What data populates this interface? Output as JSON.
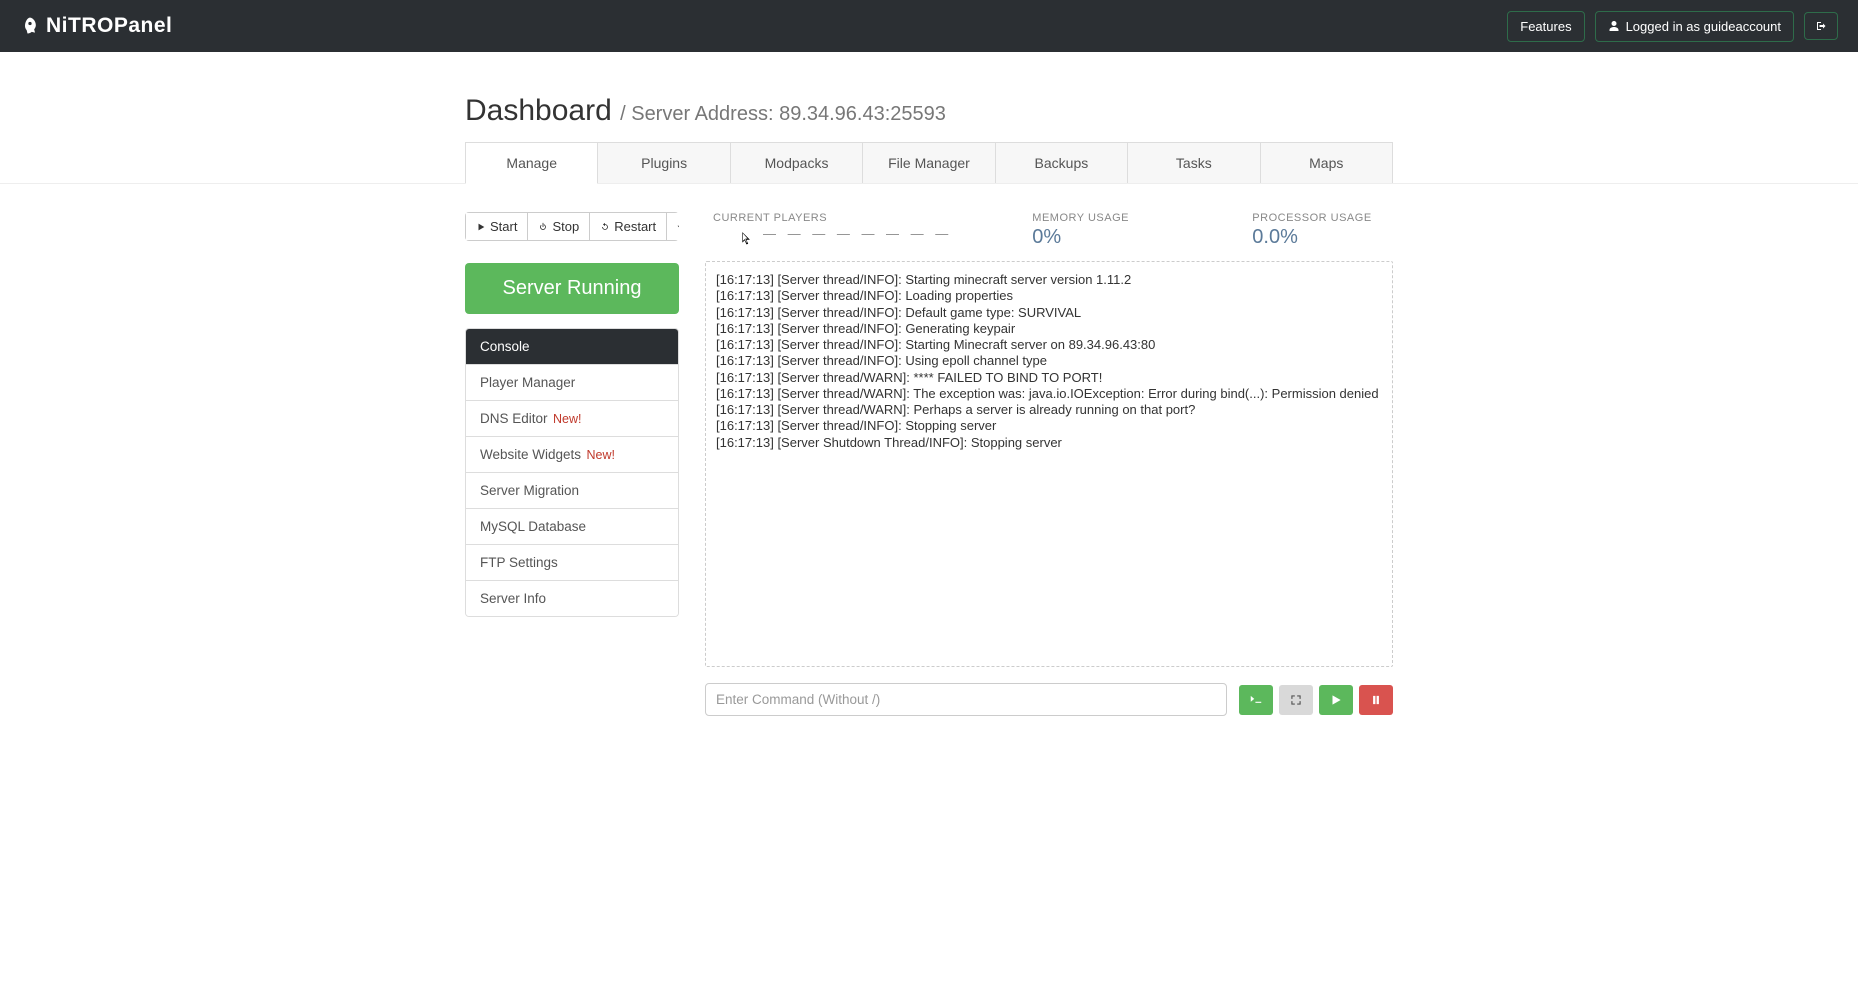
{
  "brand": "NiTROPanel",
  "header": {
    "features_label": "Features",
    "logged_in_prefix": "Logged in as ",
    "username": "guideaccount"
  },
  "page": {
    "title": "Dashboard",
    "subtitle_prefix": " / Server Address: ",
    "server_address": "89.34.96.43:25593"
  },
  "tabs": [
    "Manage",
    "Plugins",
    "Modpacks",
    "File Manager",
    "Backups",
    "Tasks",
    "Maps"
  ],
  "active_tab": 0,
  "controls": {
    "start": "Start",
    "stop": "Stop",
    "restart": "Restart"
  },
  "status_banner": "Server Running",
  "side_menu": [
    {
      "label": "Console",
      "new": false,
      "active": true
    },
    {
      "label": "Player Manager",
      "new": false,
      "active": false
    },
    {
      "label": "DNS Editor",
      "new": true,
      "active": false
    },
    {
      "label": "Website Widgets",
      "new": true,
      "active": false
    },
    {
      "label": "Server Migration",
      "new": false,
      "active": false
    },
    {
      "label": "MySQL Database",
      "new": false,
      "active": false
    },
    {
      "label": "FTP Settings",
      "new": false,
      "active": false
    },
    {
      "label": "Server Info",
      "new": false,
      "active": false
    }
  ],
  "new_badge_text": "New!",
  "stats": {
    "players_label": "CURRENT PLAYERS",
    "players_value": "— — — — — — — —",
    "memory_label": "MEMORY USAGE",
    "memory_value": "0%",
    "cpu_label": "PROCESSOR USAGE",
    "cpu_value": "0.0%"
  },
  "console_lines": [
    "[16:17:13] [Server thread/INFO]: Starting minecraft server version 1.11.2",
    "[16:17:13] [Server thread/INFO]: Loading properties",
    "[16:17:13] [Server thread/INFO]: Default game type: SURVIVAL",
    "[16:17:13] [Server thread/INFO]: Generating keypair",
    "[16:17:13] [Server thread/INFO]: Starting Minecraft server on 89.34.96.43:80",
    "[16:17:13] [Server thread/INFO]: Using epoll channel type",
    "[16:17:13] [Server thread/WARN]: **** FAILED TO BIND TO PORT!",
    "[16:17:13] [Server thread/WARN]: The exception was: java.io.IOException: Error during bind(...): Permission denied",
    "[16:17:13] [Server thread/WARN]: Perhaps a server is already running on that port?",
    "[16:17:13] [Server thread/INFO]: Stopping server",
    "[16:17:13] [Server Shutdown Thread/INFO]: Stopping server"
  ],
  "command_input_placeholder": "Enter Command (Without /)"
}
